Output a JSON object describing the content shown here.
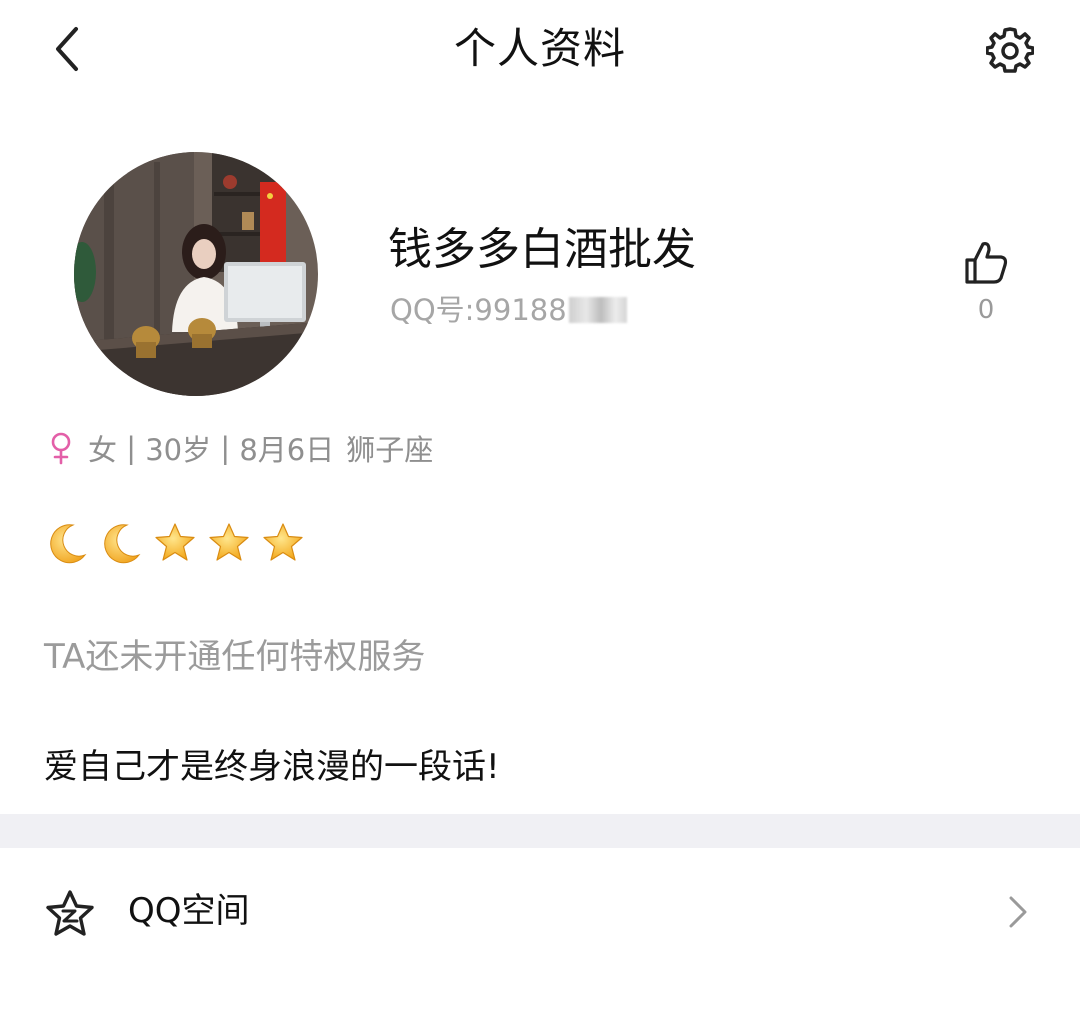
{
  "header": {
    "title": "个人资料",
    "back_icon": "chevron-left-icon",
    "settings_icon": "gear-icon"
  },
  "profile": {
    "nickname": "钱多多白酒批发",
    "qq_number_visible": "QQ号:99188",
    "like_count": "0",
    "like_icon": "thumbs-up-icon"
  },
  "info": {
    "gender_icon": "female-icon",
    "gender_color": "#e35fa8",
    "gender": "女",
    "sep1": " | ",
    "age": "30岁",
    "sep2": " | ",
    "birthday": "8月6日",
    "zodiac": "狮子座"
  },
  "level": {
    "icons": [
      "moon-icon",
      "moon-icon",
      "star-icon",
      "star-icon",
      "star-icon"
    ],
    "moon_color": "#f5b323",
    "star_color": "#f5b323"
  },
  "privilege_text": "TA还未开通任何特权服务",
  "signature": "爱自己才是终身浪漫的一段话!",
  "qq_space": {
    "label": "QQ空间",
    "icon": "qzone-star-icon",
    "chevron_icon": "chevron-right-icon"
  }
}
